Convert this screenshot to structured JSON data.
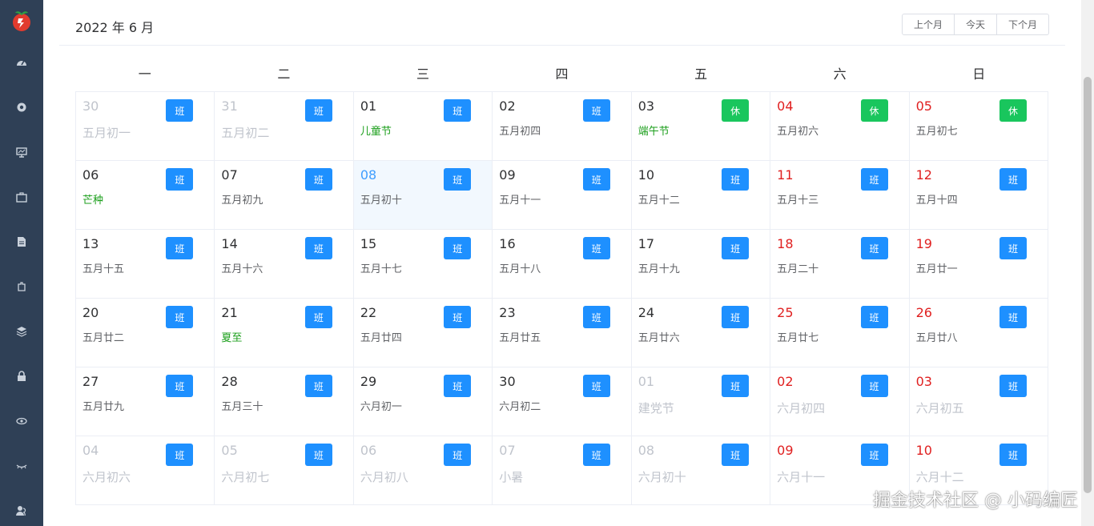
{
  "header": {
    "title": "2022 年 6 月",
    "prev_label": "上个月",
    "today_label": "今天",
    "next_label": "下个月"
  },
  "weekdays": [
    "一",
    "二",
    "三",
    "四",
    "五",
    "六",
    "日"
  ],
  "cells": [
    {
      "day": "30",
      "lunar": "五月初一",
      "tag": "班",
      "tag_type": "work",
      "other": true,
      "weekend": false,
      "festival": false
    },
    {
      "day": "31",
      "lunar": "五月初二",
      "tag": "班",
      "tag_type": "work",
      "other": true,
      "weekend": false,
      "festival": false
    },
    {
      "day": "01",
      "lunar": "儿童节",
      "tag": "班",
      "tag_type": "work",
      "other": false,
      "weekend": false,
      "festival": true
    },
    {
      "day": "02",
      "lunar": "五月初四",
      "tag": "班",
      "tag_type": "work",
      "other": false,
      "weekend": false,
      "festival": false
    },
    {
      "day": "03",
      "lunar": "端午节",
      "tag": "休",
      "tag_type": "rest",
      "other": false,
      "weekend": false,
      "festival": true
    },
    {
      "day": "04",
      "lunar": "五月初六",
      "tag": "休",
      "tag_type": "rest",
      "other": false,
      "weekend": true,
      "festival": false
    },
    {
      "day": "05",
      "lunar": "五月初七",
      "tag": "休",
      "tag_type": "rest",
      "other": false,
      "weekend": true,
      "festival": false
    },
    {
      "day": "06",
      "lunar": "芒种",
      "tag": "班",
      "tag_type": "work",
      "other": false,
      "weekend": false,
      "festival": true
    },
    {
      "day": "07",
      "lunar": "五月初九",
      "tag": "班",
      "tag_type": "work",
      "other": false,
      "weekend": false,
      "festival": false
    },
    {
      "day": "08",
      "lunar": "五月初十",
      "tag": "班",
      "tag_type": "work",
      "other": false,
      "weekend": false,
      "festival": false,
      "today": true
    },
    {
      "day": "09",
      "lunar": "五月十一",
      "tag": "班",
      "tag_type": "work",
      "other": false,
      "weekend": false,
      "festival": false
    },
    {
      "day": "10",
      "lunar": "五月十二",
      "tag": "班",
      "tag_type": "work",
      "other": false,
      "weekend": false,
      "festival": false
    },
    {
      "day": "11",
      "lunar": "五月十三",
      "tag": "班",
      "tag_type": "work",
      "other": false,
      "weekend": true,
      "festival": false
    },
    {
      "day": "12",
      "lunar": "五月十四",
      "tag": "班",
      "tag_type": "work",
      "other": false,
      "weekend": true,
      "festival": false
    },
    {
      "day": "13",
      "lunar": "五月十五",
      "tag": "班",
      "tag_type": "work",
      "other": false,
      "weekend": false,
      "festival": false
    },
    {
      "day": "14",
      "lunar": "五月十六",
      "tag": "班",
      "tag_type": "work",
      "other": false,
      "weekend": false,
      "festival": false
    },
    {
      "day": "15",
      "lunar": "五月十七",
      "tag": "班",
      "tag_type": "work",
      "other": false,
      "weekend": false,
      "festival": false
    },
    {
      "day": "16",
      "lunar": "五月十八",
      "tag": "班",
      "tag_type": "work",
      "other": false,
      "weekend": false,
      "festival": false
    },
    {
      "day": "17",
      "lunar": "五月十九",
      "tag": "班",
      "tag_type": "work",
      "other": false,
      "weekend": false,
      "festival": false
    },
    {
      "day": "18",
      "lunar": "五月二十",
      "tag": "班",
      "tag_type": "work",
      "other": false,
      "weekend": true,
      "festival": false
    },
    {
      "day": "19",
      "lunar": "五月廿一",
      "tag": "班",
      "tag_type": "work",
      "other": false,
      "weekend": true,
      "festival": false
    },
    {
      "day": "20",
      "lunar": "五月廿二",
      "tag": "班",
      "tag_type": "work",
      "other": false,
      "weekend": false,
      "festival": false
    },
    {
      "day": "21",
      "lunar": "夏至",
      "tag": "班",
      "tag_type": "work",
      "other": false,
      "weekend": false,
      "festival": true
    },
    {
      "day": "22",
      "lunar": "五月廿四",
      "tag": "班",
      "tag_type": "work",
      "other": false,
      "weekend": false,
      "festival": false
    },
    {
      "day": "23",
      "lunar": "五月廿五",
      "tag": "班",
      "tag_type": "work",
      "other": false,
      "weekend": false,
      "festival": false
    },
    {
      "day": "24",
      "lunar": "五月廿六",
      "tag": "班",
      "tag_type": "work",
      "other": false,
      "weekend": false,
      "festival": false
    },
    {
      "day": "25",
      "lunar": "五月廿七",
      "tag": "班",
      "tag_type": "work",
      "other": false,
      "weekend": true,
      "festival": false
    },
    {
      "day": "26",
      "lunar": "五月廿八",
      "tag": "班",
      "tag_type": "work",
      "other": false,
      "weekend": true,
      "festival": false
    },
    {
      "day": "27",
      "lunar": "五月廿九",
      "tag": "班",
      "tag_type": "work",
      "other": false,
      "weekend": false,
      "festival": false
    },
    {
      "day": "28",
      "lunar": "五月三十",
      "tag": "班",
      "tag_type": "work",
      "other": false,
      "weekend": false,
      "festival": false
    },
    {
      "day": "29",
      "lunar": "六月初一",
      "tag": "班",
      "tag_type": "work",
      "other": false,
      "weekend": false,
      "festival": false
    },
    {
      "day": "30",
      "lunar": "六月初二",
      "tag": "班",
      "tag_type": "work",
      "other": false,
      "weekend": false,
      "festival": false
    },
    {
      "day": "01",
      "lunar": "建党节",
      "tag": "班",
      "tag_type": "work",
      "other": true,
      "weekend": false,
      "festival": true
    },
    {
      "day": "02",
      "lunar": "六月初四",
      "tag": "班",
      "tag_type": "work",
      "other": true,
      "weekend": true,
      "festival": false
    },
    {
      "day": "03",
      "lunar": "六月初五",
      "tag": "班",
      "tag_type": "work",
      "other": true,
      "weekend": true,
      "festival": false
    },
    {
      "day": "04",
      "lunar": "六月初六",
      "tag": "班",
      "tag_type": "work",
      "other": true,
      "weekend": false,
      "festival": false
    },
    {
      "day": "05",
      "lunar": "六月初七",
      "tag": "班",
      "tag_type": "work",
      "other": true,
      "weekend": false,
      "festival": false
    },
    {
      "day": "06",
      "lunar": "六月初八",
      "tag": "班",
      "tag_type": "work",
      "other": true,
      "weekend": false,
      "festival": false
    },
    {
      "day": "07",
      "lunar": "小暑",
      "tag": "班",
      "tag_type": "work",
      "other": true,
      "weekend": false,
      "festival": true
    },
    {
      "day": "08",
      "lunar": "六月初十",
      "tag": "班",
      "tag_type": "work",
      "other": true,
      "weekend": false,
      "festival": false
    },
    {
      "day": "09",
      "lunar": "六月十一",
      "tag": "班",
      "tag_type": "work",
      "other": true,
      "weekend": true,
      "festival": false
    },
    {
      "day": "10",
      "lunar": "六月十二",
      "tag": "班",
      "tag_type": "work",
      "other": true,
      "weekend": true,
      "festival": false
    }
  ],
  "sidebar": {
    "icons": [
      "dashboard-icon",
      "gear-icon",
      "monitor-icon",
      "briefcase-icon",
      "document-icon",
      "puzzle-icon",
      "layers-icon",
      "lock-icon",
      "eye-icon",
      "eye-closed-icon",
      "user-icon"
    ]
  },
  "watermark": "掘金技术社区 @ 小码编匠",
  "colors": {
    "sidebar_bg": "#2f4056",
    "work_tag": "#1e90ff",
    "rest_tag": "#19c65d",
    "weekend_text": "#e02020",
    "festival_text": "#1a9e1a",
    "today_bg": "#f2f8fe"
  }
}
